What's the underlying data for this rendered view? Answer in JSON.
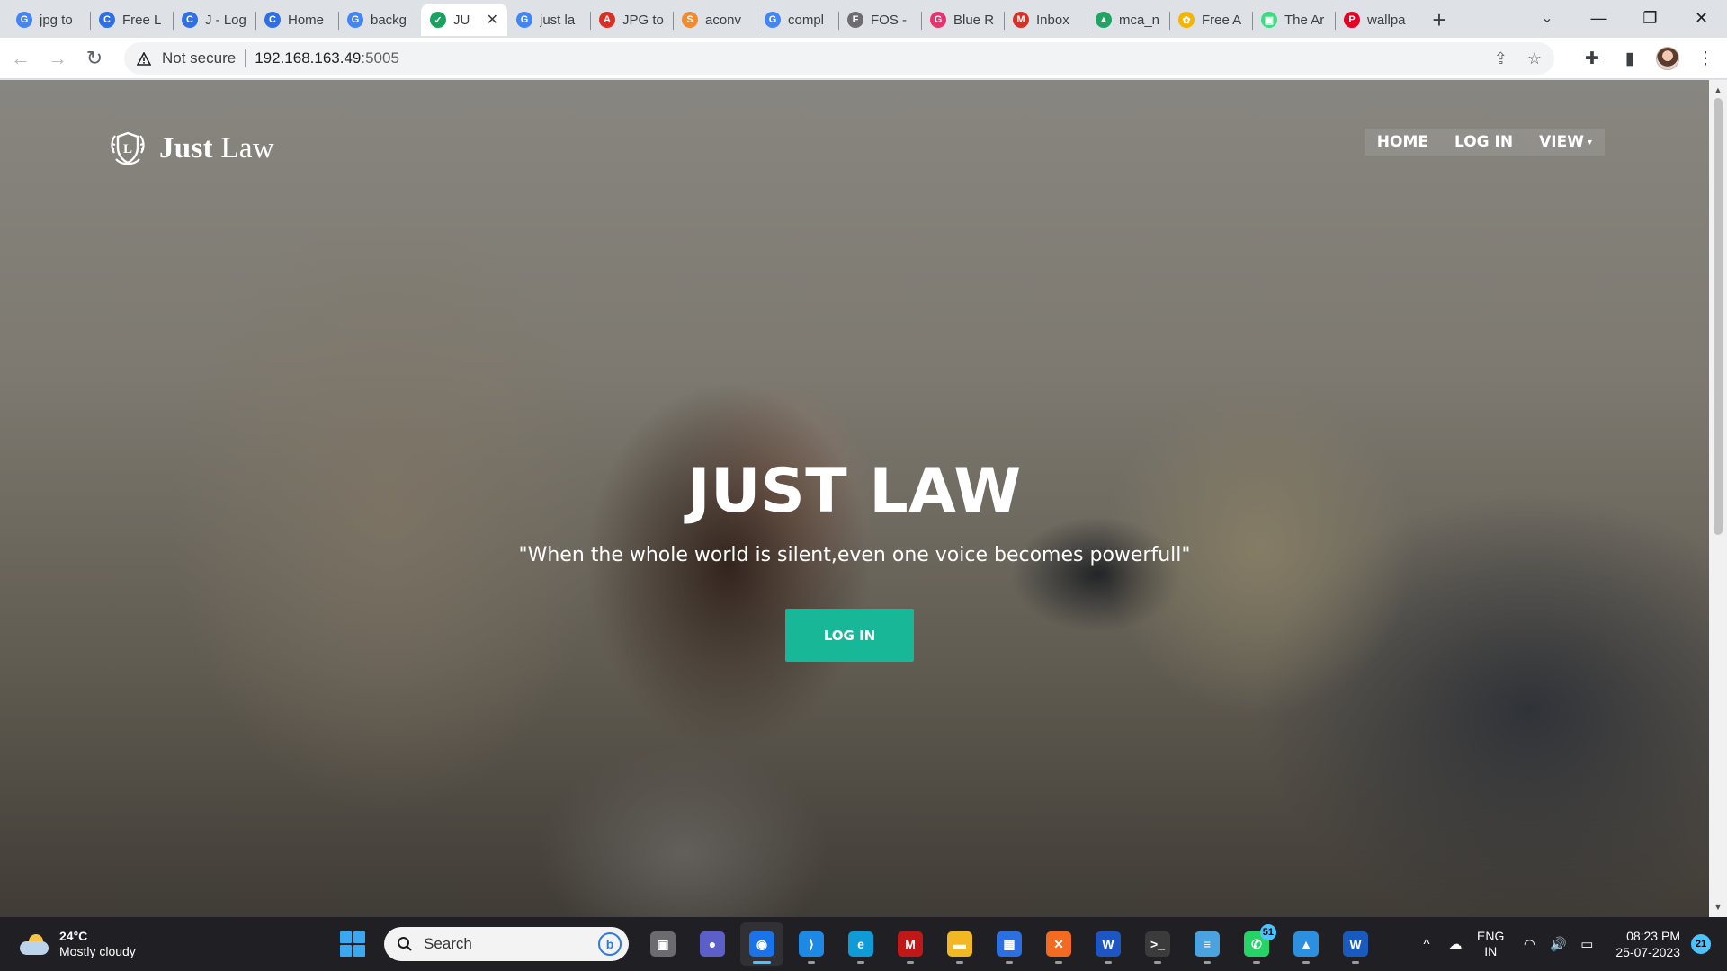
{
  "browser": {
    "tabs": [
      {
        "title": "jpg to",
        "icon": "google-icon",
        "color": "#4285f4",
        "glyph": "G"
      },
      {
        "title": "Free L",
        "icon": "chatgpt-icon",
        "color": "#2f6fe4",
        "glyph": "C"
      },
      {
        "title": "J - Log",
        "icon": "chatgpt-icon",
        "color": "#2f6fe4",
        "glyph": "C"
      },
      {
        "title": "Home",
        "icon": "chatgpt-icon",
        "color": "#2f6fe4",
        "glyph": "C"
      },
      {
        "title": "backg",
        "icon": "google-icon",
        "color": "#4285f4",
        "glyph": "G"
      },
      {
        "title": "JU",
        "icon": "check-icon",
        "color": "#1aa260",
        "glyph": "✓",
        "active": true
      },
      {
        "title": "just la",
        "icon": "google-icon",
        "color": "#4285f4",
        "glyph": "G"
      },
      {
        "title": "JPG to",
        "icon": "pdf-icon",
        "color": "#d93025",
        "glyph": "A"
      },
      {
        "title": "aconv",
        "icon": "aconvert-icon",
        "color": "#f28b30",
        "glyph": "S"
      },
      {
        "title": "compl",
        "icon": "google-icon",
        "color": "#4285f4",
        "glyph": "G"
      },
      {
        "title": "FOS -",
        "icon": "fos-icon",
        "color": "#6d6d6d",
        "glyph": "F"
      },
      {
        "title": "Blue R",
        "icon": "gallery-icon",
        "color": "#e8336e",
        "glyph": "G"
      },
      {
        "title": "Inbox",
        "icon": "gmail-icon",
        "color": "#d93025",
        "glyph": "M"
      },
      {
        "title": "mca_n",
        "icon": "drive-icon",
        "color": "#1fa463",
        "glyph": "▲"
      },
      {
        "title": "Free A",
        "icon": "puzzle-app-icon",
        "color": "#f4b400",
        "glyph": "✿"
      },
      {
        "title": "The Ar",
        "icon": "android-icon",
        "color": "#3ddc84",
        "glyph": "▣"
      },
      {
        "title": "wallpa",
        "icon": "pinterest-icon",
        "color": "#e60023",
        "glyph": "P"
      }
    ],
    "newtab_glyph": "+",
    "tab_search_glyph": "⌄",
    "window": {
      "minimize": "—",
      "restore": "❐",
      "close": "✕"
    },
    "nav": {
      "back": "←",
      "forward": "→",
      "reload": "↻"
    },
    "address": {
      "security_label": "Not secure",
      "host": "192.168.163.49",
      "port": ":5005"
    },
    "toolbar_icons": {
      "share": "⇪",
      "bookmark": "☆",
      "extensions": "✚",
      "sidepanel": "▮",
      "menu": "⋮"
    }
  },
  "site": {
    "brand": {
      "strong": "Just",
      "light": "Law",
      "logo_letter": "L"
    },
    "menu": [
      {
        "label": "HOME"
      },
      {
        "label": "LOG IN"
      },
      {
        "label": "VIEW",
        "caret": "▾"
      }
    ],
    "hero": {
      "title": "JUST LAW",
      "quote": "\"When the whole world is silent,even one voice becomes powerfull\"",
      "button": "LOG IN"
    },
    "accent_color": "#18b797"
  },
  "scrollbar": {
    "up": "▲",
    "down": "▼"
  },
  "taskbar": {
    "weather": {
      "temp": "24°C",
      "desc": "Mostly cloudy"
    },
    "search_label": "Search",
    "apps": [
      {
        "name": "taskview-icon",
        "color": "#6b6b70",
        "glyph": "▣"
      },
      {
        "name": "teams-chat-icon",
        "color": "#5b5fc7",
        "glyph": "●"
      },
      {
        "name": "chrome-icon",
        "color": "#1a73e8",
        "glyph": "◉",
        "active": true
      },
      {
        "name": "vscode-icon",
        "color": "#1e88e5",
        "glyph": "⟩"
      },
      {
        "name": "edge-icon",
        "color": "#0f9bd7",
        "glyph": "e"
      },
      {
        "name": "mcafee-icon",
        "color": "#c01818",
        "glyph": "M"
      },
      {
        "name": "file-explorer-icon",
        "color": "#f2b824",
        "glyph": "▬"
      },
      {
        "name": "store-icon",
        "color": "#2b6fe0",
        "glyph": "▦"
      },
      {
        "name": "xampp-icon",
        "color": "#f26b21",
        "glyph": "✕"
      },
      {
        "name": "wordpad-icon",
        "color": "#1d56c2",
        "glyph": "W"
      },
      {
        "name": "terminal-icon",
        "color": "#3b3b3b",
        "glyph": ">_"
      },
      {
        "name": "notepad-icon",
        "color": "#4aa3df",
        "glyph": "≡"
      },
      {
        "name": "whatsapp-icon",
        "color": "#25d366",
        "glyph": "✆",
        "badge": "51"
      },
      {
        "name": "photos-icon",
        "color": "#2d8fe0",
        "glyph": "▲"
      },
      {
        "name": "word-icon",
        "color": "#185abd",
        "glyph": "W"
      }
    ],
    "tray": {
      "chevron": "^",
      "onedrive": "☁",
      "lang_top": "ENG",
      "lang_bottom": "IN",
      "wifi": "◠",
      "volume": "🔊",
      "battery": "▭",
      "time": "08:23 PM",
      "date": "25-07-2023",
      "notifications": "21"
    }
  }
}
